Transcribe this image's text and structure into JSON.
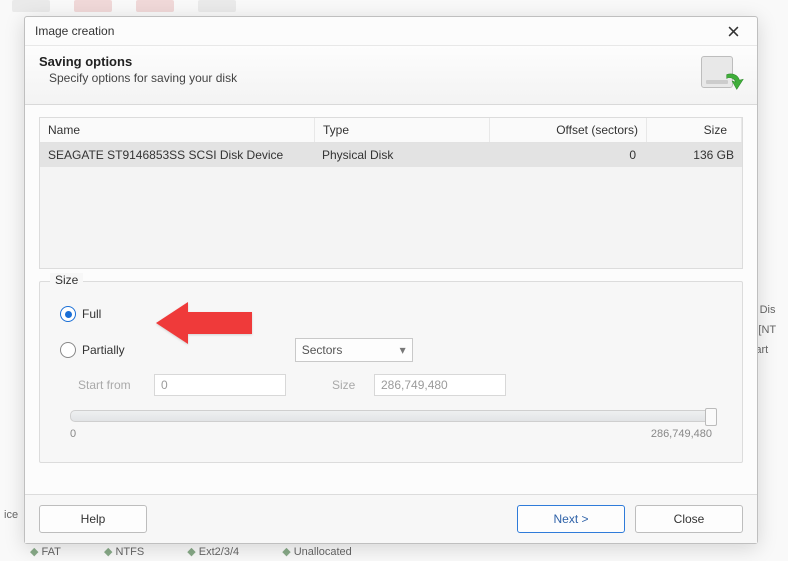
{
  "window": {
    "title": "Image creation"
  },
  "header": {
    "title": "Saving options",
    "subtitle": "Specify options for saving your disk"
  },
  "table": {
    "columns": {
      "name": "Name",
      "type": "Type",
      "offset": "Offset (sectors)",
      "size": "Size"
    },
    "rows": [
      {
        "name": "SEAGATE ST9146853SS SCSI Disk Device",
        "type": "Physical Disk",
        "offset": "0",
        "size": "136 GB"
      }
    ]
  },
  "size_group": {
    "legend": "Size",
    "full_label": "Full",
    "partially_label": "Partially",
    "unit_select": "Sectors",
    "start_from_label": "Start from",
    "start_from_value": "0",
    "size_label": "Size",
    "size_value": "286,749,480",
    "slider_min": "0",
    "slider_max": "286,749,480"
  },
  "buttons": {
    "help": "Help",
    "next": "Next >",
    "close": "Close"
  },
  "background": {
    "right1": "al Dis",
    "right2": "B [NT",
    "right3": "Part",
    "b1": "FAT",
    "b2": "NTFS",
    "b3": "Ext2/3/4",
    "b4": "Unallocated",
    "ice": "ice"
  }
}
